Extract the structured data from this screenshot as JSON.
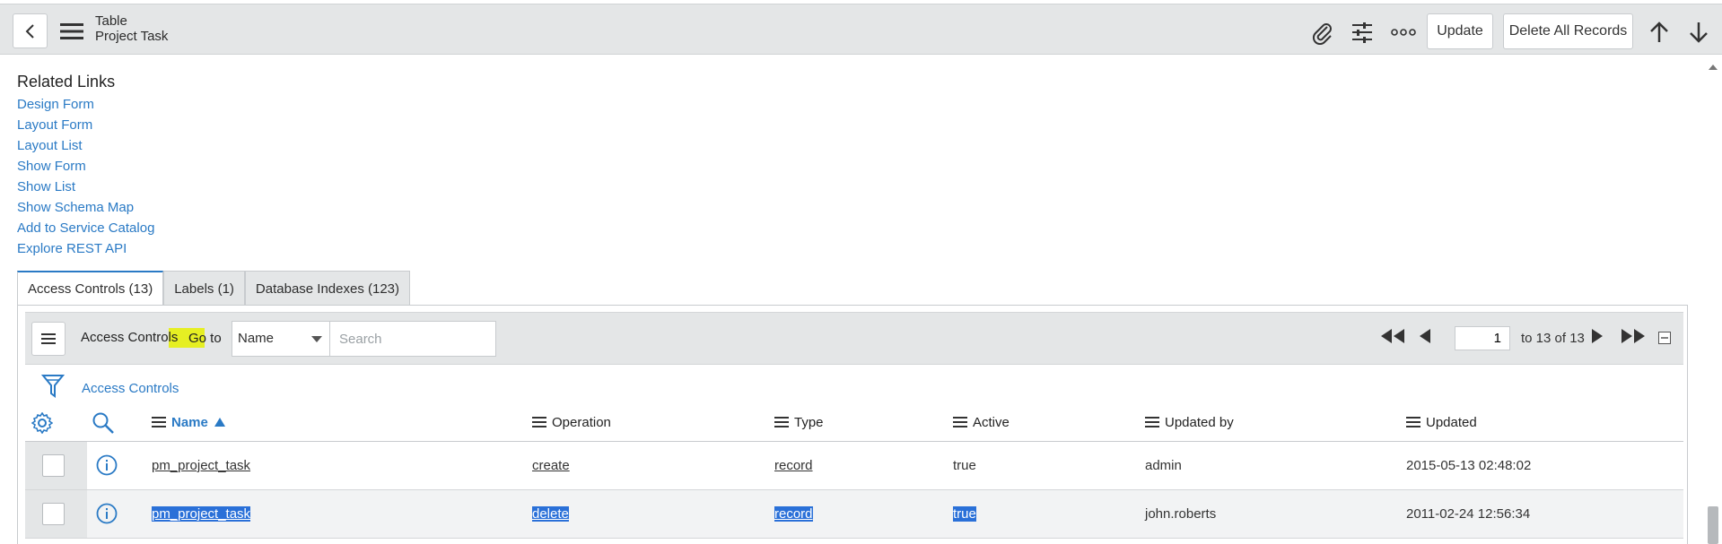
{
  "header": {
    "title": "Table",
    "subtitle": "Project Task",
    "update_label": "Update",
    "delete_all_label": "Delete All Records"
  },
  "related": {
    "title": "Related Links",
    "links": [
      "Design Form",
      "Layout Form",
      "Layout List",
      "Show Form",
      "Show List",
      "Show Schema Map",
      "Add to Service Catalog",
      "Explore REST API"
    ]
  },
  "tabs": [
    "Access Controls (13)",
    "Labels (1)",
    "Database Indexes (123)"
  ],
  "list": {
    "title": "Access Controls",
    "goto_label": "Go to",
    "goto_select_value": "Name",
    "search_placeholder": "Search",
    "page_value": "1",
    "page_range": "to 13 of 13",
    "filter_label": "Access Controls"
  },
  "columns": {
    "name": "Name",
    "operation": "Operation",
    "type": "Type",
    "active": "Active",
    "updated_by": "Updated by",
    "updated": "Updated"
  },
  "rows": [
    {
      "name": "pm_project_task",
      "operation": "create",
      "type": "record",
      "active": "true",
      "updated_by": "admin",
      "updated": "2015-05-13 02:48:02"
    },
    {
      "name": "pm_project_task",
      "operation": "delete",
      "type": "record",
      "active": "true",
      "updated_by": "john.roberts",
      "updated": "2011-02-24 12:56:34"
    }
  ],
  "colors": {
    "link": "#2a7ac5",
    "header_bg": "#e4e6e7",
    "selection": "#2a70d8",
    "highlight": "#e6ef18"
  }
}
